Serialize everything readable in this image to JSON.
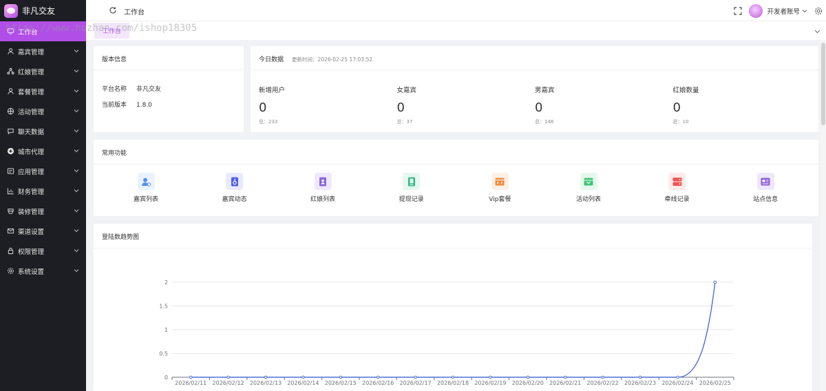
{
  "app": {
    "name": "非凡交友"
  },
  "sidebar": {
    "items": [
      {
        "label": "工作台",
        "icon": "monitor-icon",
        "active": true
      },
      {
        "label": "嘉宾管理",
        "icon": "user-icon"
      },
      {
        "label": "红娘管理",
        "icon": "network-icon"
      },
      {
        "label": "套餐管理",
        "icon": "user-icon"
      },
      {
        "label": "活动管理",
        "icon": "globe-icon"
      },
      {
        "label": "聊天数据",
        "icon": "chat-icon"
      },
      {
        "label": "城市代理",
        "icon": "plus-circle-icon"
      },
      {
        "label": "应用管理",
        "icon": "app-icon"
      },
      {
        "label": "财务管理",
        "icon": "chart-icon"
      },
      {
        "label": "装修管理",
        "icon": "brush-icon"
      },
      {
        "label": "渠道设置",
        "icon": "mail-icon"
      },
      {
        "label": "权限管理",
        "icon": "lock-icon"
      },
      {
        "label": "系统设置",
        "icon": "gear-icon"
      }
    ]
  },
  "header": {
    "breadcrumb": "工作台",
    "account": "开发者账号"
  },
  "tags": {
    "active": "工作台"
  },
  "watermark": "https://www.huzhan.com/ishop18305",
  "version": {
    "title": "版本信息",
    "rows": [
      {
        "label": "平台名称",
        "value": "非凡交友"
      },
      {
        "label": "当前版本",
        "value": "1.8.0"
      }
    ]
  },
  "today": {
    "title": "今日数据",
    "updated": "更新时间：2026-02-25 17:03:52",
    "stats": [
      {
        "label": "新增用户",
        "value": "0",
        "sub": "总：233"
      },
      {
        "label": "女嘉宾",
        "value": "0",
        "sub": "总：37"
      },
      {
        "label": "男嘉宾",
        "value": "0",
        "sub": "总：148"
      },
      {
        "label": "红娘数量",
        "value": "0",
        "sub": "总：10"
      }
    ]
  },
  "functions": {
    "title": "常用功能",
    "items": [
      {
        "label": "嘉宾列表",
        "icon": "user-list-icon",
        "color": "#4f8ff7",
        "bg": "#eaf2fe"
      },
      {
        "label": "嘉宾动态",
        "icon": "badge-icon",
        "color": "#4f5ee8",
        "bg": "#e8eaff"
      },
      {
        "label": "红娘列表",
        "icon": "book-icon",
        "color": "#8c67e0",
        "bg": "#efe9fc"
      },
      {
        "label": "提现记录",
        "icon": "doc-icon",
        "color": "#2fb886",
        "bg": "#e6f7f0"
      },
      {
        "label": "Vip套餐",
        "icon": "code-icon",
        "color": "#f38a3b",
        "bg": "#fdf0e5"
      },
      {
        "label": "活动列表",
        "icon": "box-icon",
        "color": "#3ec476",
        "bg": "#e6f8ee"
      },
      {
        "label": "牵线记录",
        "icon": "server-icon",
        "color": "#f05656",
        "bg": "#fdeaea"
      },
      {
        "label": "站点信息",
        "icon": "card-icon",
        "color": "#8a5ae0",
        "bg": "#efe7fc"
      }
    ]
  },
  "chart_data": {
    "type": "line",
    "title": "登陆数趋势图",
    "categories": [
      "2026/02/11",
      "2026/02/12",
      "2026/02/13",
      "2026/02/14",
      "2026/02/15",
      "2026/02/16",
      "2026/02/17",
      "2026/02/18",
      "2026/02/19",
      "2026/02/20",
      "2026/02/21",
      "2026/02/22",
      "2026/02/23",
      "2026/02/24",
      "2026/02/25"
    ],
    "series": [
      {
        "values": [
          0,
          0,
          0,
          0,
          0,
          0,
          0,
          0,
          0,
          0,
          0,
          0,
          0,
          0,
          2
        ]
      }
    ],
    "ylim": [
      0,
      2
    ],
    "yticks": [
      "0",
      "0.5",
      "1",
      "1.5",
      "2"
    ],
    "grid": true,
    "color": "#4e6fd6"
  }
}
